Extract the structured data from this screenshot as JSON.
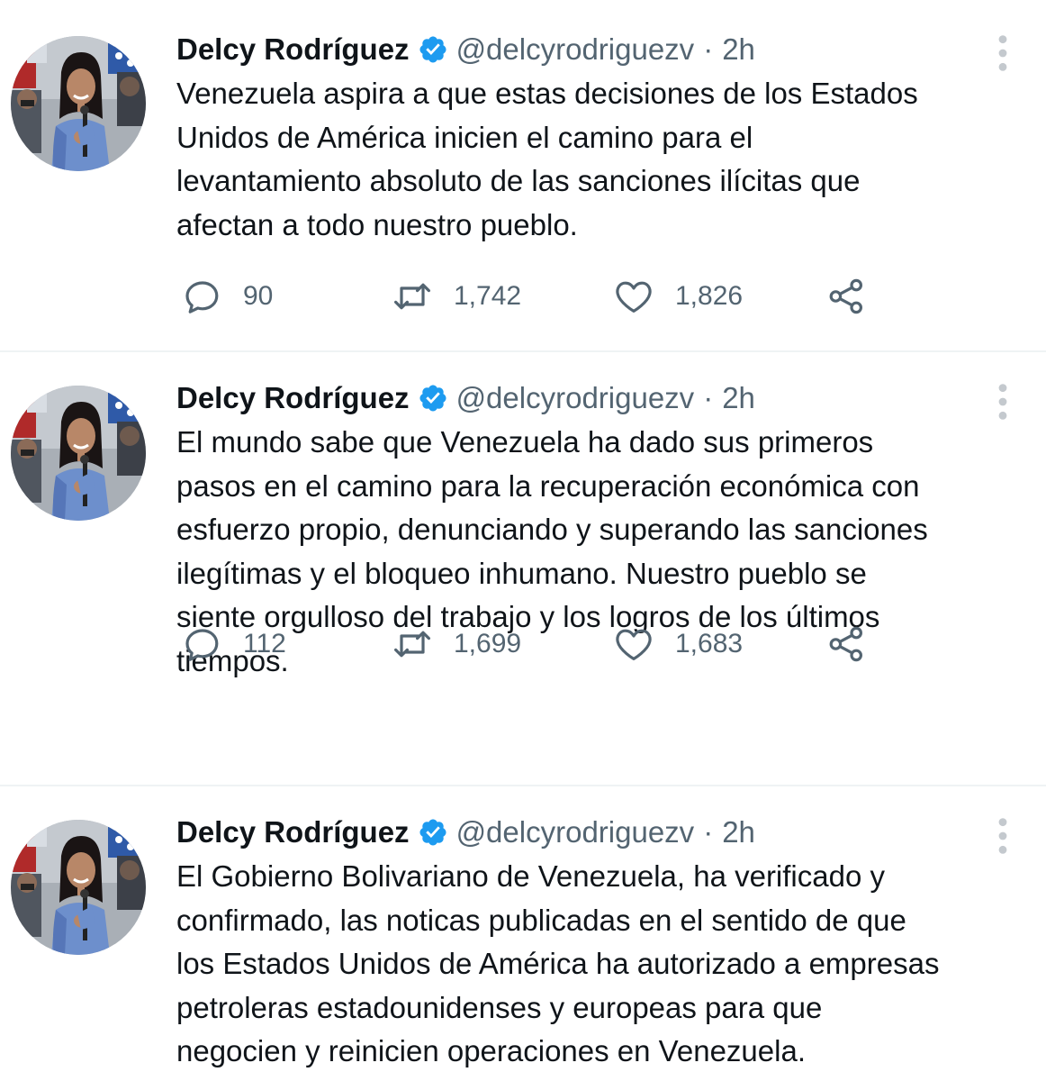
{
  "colors": {
    "verified_badge": "#1d9bf0",
    "text_primary": "#0f1419",
    "text_secondary": "#536471",
    "divider": "#eff3f4"
  },
  "tweets": [
    {
      "author": {
        "name": "Delcy Rodríguez",
        "handle": "@delcyrodriguezv",
        "verified": true
      },
      "separator": "·",
      "time": "2h",
      "text": "Venezuela aspira a que estas decisiones de los Estados\nUnidos de América inicien el camino para el\nlevantamiento absoluto de las sanciones ilícitas que\nafectan a todo nuestro pueblo.",
      "stats": {
        "replies": "90",
        "retweets": "1,742",
        "likes": "1,826"
      },
      "icons": [
        "reply-icon",
        "retweet-icon",
        "like-icon",
        "share-icon",
        "more-icon"
      ]
    },
    {
      "author": {
        "name": "Delcy Rodríguez",
        "handle": "@delcyrodriguezv",
        "verified": true
      },
      "separator": "·",
      "time": "2h",
      "text": "El mundo sabe que Venezuela ha dado sus primeros\npasos en el camino para la recuperación económica con\nesfuerzo propio, denunciando y superando las sanciones\nilegítimas y el bloqueo inhumano. Nuestro pueblo se\nsiente orgulloso del trabajo y los logros de los últimos\ntiempos.",
      "stats": {
        "replies": "112",
        "retweets": "1,699",
        "likes": "1,683"
      },
      "icons": [
        "reply-icon",
        "retweet-icon",
        "like-icon",
        "share-icon",
        "more-icon"
      ]
    },
    {
      "author": {
        "name": "Delcy Rodríguez",
        "handle": "@delcyrodriguezv",
        "verified": true
      },
      "separator": "·",
      "time": "2h",
      "text": "El Gobierno Bolivariano de Venezuela, ha verificado y\nconfirmado, las noticas publicadas en el sentido de que\nlos Estados Unidos de América ha autorizado a empresas\npetroleras estadounidenses y europeas para que\nnegocien y reinicien operaciones en Venezuela.",
      "icons": [
        "more-icon"
      ]
    }
  ]
}
